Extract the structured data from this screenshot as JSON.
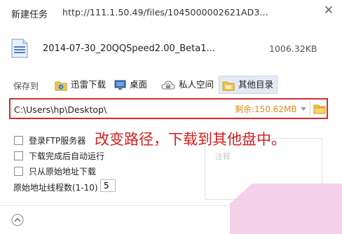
{
  "header": {
    "title": "新建任务",
    "url": "http://111.1.50.49/files/1045000002621AD3..."
  },
  "file": {
    "name": "2014-07-30_20QQSpeed2.00_Beta1...",
    "size": "1006.32KB"
  },
  "save_to": {
    "label": "保存到",
    "locations": [
      {
        "label": "迅雷下载",
        "icon": "thunder-folder-icon"
      },
      {
        "label": "桌面",
        "icon": "desktop-icon"
      },
      {
        "label": "私人空间",
        "icon": "cloud-icon"
      },
      {
        "label": "其他目录",
        "icon": "folder-icon",
        "active": true
      }
    ]
  },
  "path": {
    "value": "C:\\Users\\hp\\Desktop\\",
    "free_space": "剩余:150.62MB"
  },
  "options": [
    {
      "label": "登录FTP服务器",
      "checked": false
    },
    {
      "label": "下载完成后自动运行",
      "checked": false
    },
    {
      "label": "只从原始地址下载",
      "checked": false
    }
  ],
  "threads": {
    "label": "原始地址线程数(1-10)",
    "value": "5"
  },
  "note": {
    "placeholder": "注释"
  },
  "annotation": {
    "text": "改变路径，下载到其他盘中。",
    "color": "#d42020"
  },
  "colors": {
    "highlight_border": "#d42b2b",
    "free_space": "#e08a1e",
    "active_location_bg": "#e4eaf4"
  }
}
